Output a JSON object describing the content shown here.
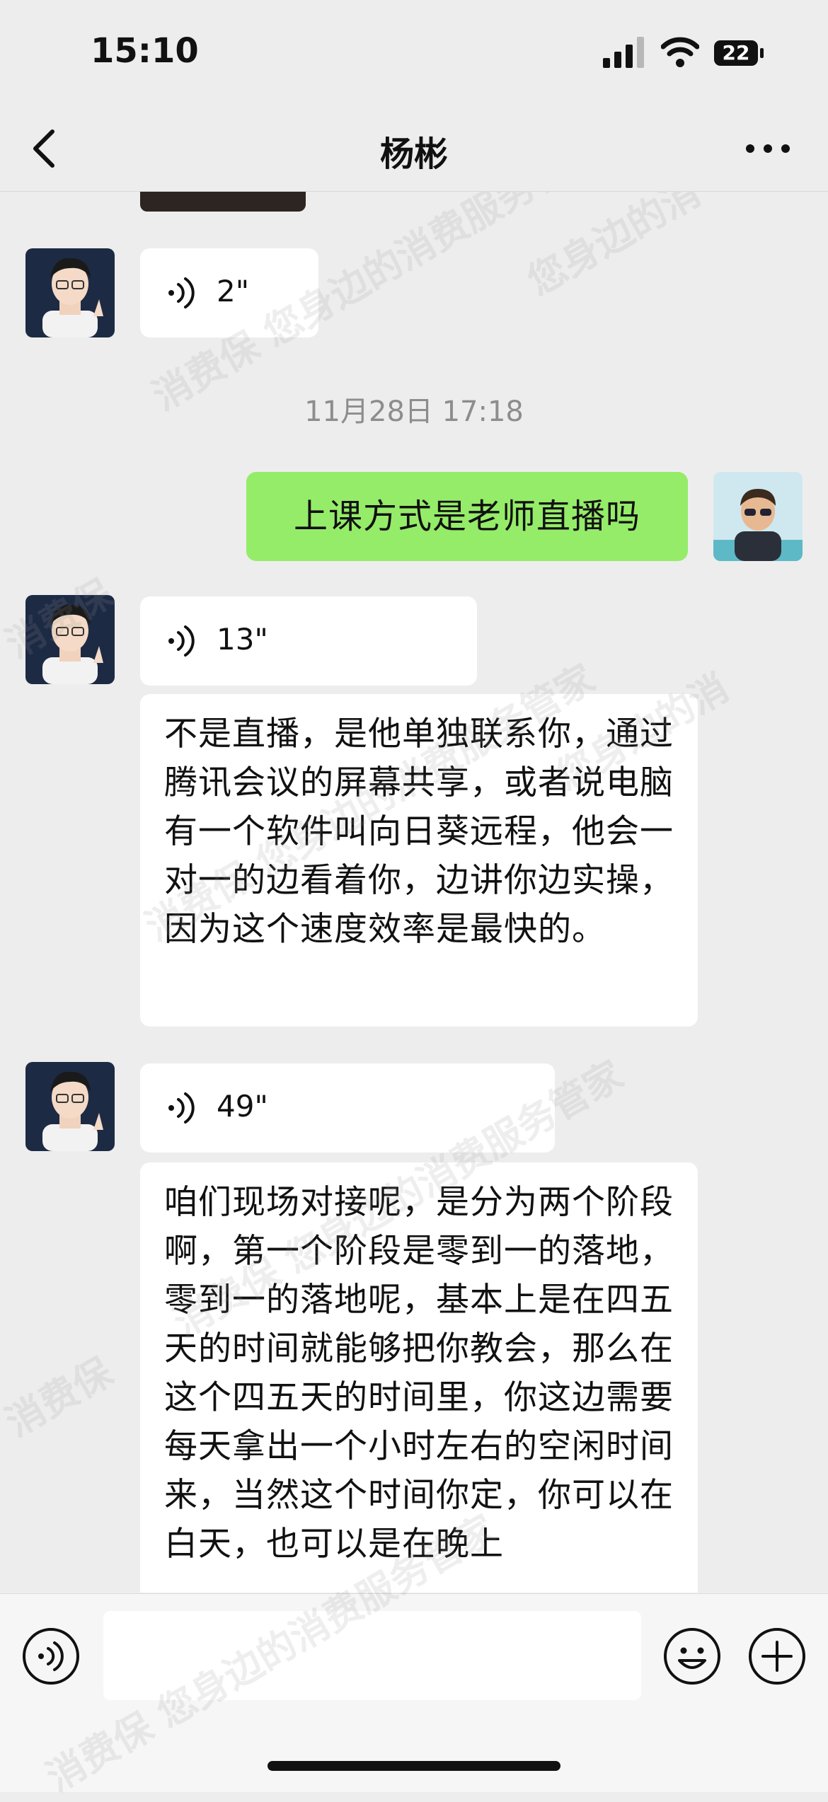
{
  "status_bar": {
    "time": "15:10",
    "battery": "22"
  },
  "nav": {
    "title": "杨彬"
  },
  "messages": [
    {
      "type": "voice",
      "duration": "2\""
    },
    {
      "type": "timestamp",
      "text": "11月28日 17:18"
    },
    {
      "type": "text",
      "from": "me",
      "text": "上课方式是老师直播吗"
    },
    {
      "type": "voice",
      "duration": "13\""
    },
    {
      "type": "text",
      "text": "不是直播，是他单独联系你，通过腾讯会议的屏幕共享，或者说电脑有一个软件叫向日葵远程，他会一对一的边看着你，边讲你边实操，因为这个速度效率是最快的。"
    },
    {
      "type": "voice",
      "duration": "49\""
    },
    {
      "type": "text",
      "text": "咱们现场对接呢，是分为两个阶段啊，第一个阶段是零到一的落地，零到一的落地呢，基本上是在四五天的时间就能够把你教会，那么在这个四五天的时间里，你这边需要每天拿出一个小时左右的空闲时间来，当然这个时间你定，你可以在白天，也可以是在晚上"
    }
  ],
  "watermark": {
    "text_a": "消费保 您身边的消费服务管家",
    "text_b": "消费保",
    "text_c": "您身边的消"
  },
  "icons": {
    "back": "chevron-left-icon",
    "more": "ellipsis-icon",
    "voice_toggle": "voice-icon",
    "emoji": "emoji-icon",
    "add": "plus-icon"
  }
}
